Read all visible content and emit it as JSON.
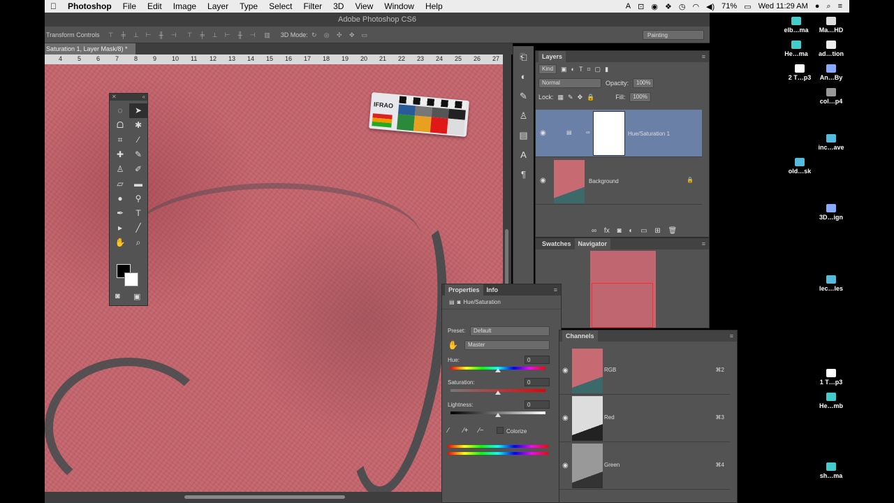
{
  "menubar": {
    "apple": "",
    "app": "Photoshop",
    "items": [
      "File",
      "Edit",
      "Image",
      "Layer",
      "Type",
      "Select",
      "Filter",
      "3D",
      "View",
      "Window",
      "Help"
    ],
    "battery": "71%",
    "clock": "Wed 11:29 AM"
  },
  "window_title": "Adobe Photoshop CS6",
  "options": {
    "transform_label": "Transform Controls",
    "mode3d_label": "3D Mode:",
    "workspace": "Painting"
  },
  "doc_tab": "Saturation 1, Layer Mask/8) *",
  "ruler_ticks": [
    "4",
    "5",
    "6",
    "7",
    "8",
    "9",
    "10",
    "11",
    "12",
    "13",
    "14",
    "15",
    "16",
    "17",
    "18",
    "19",
    "20",
    "21",
    "22",
    "23",
    "24",
    "25",
    "26",
    "27"
  ],
  "layers_panel": {
    "tab": "Layers",
    "kind": "Kind",
    "blend": "Normal",
    "opacity_label": "Opacity:",
    "opacity": "100%",
    "lock_label": "Lock:",
    "fill_label": "Fill:",
    "fill": "100%",
    "layers": [
      {
        "name": "Hue/Saturation 1"
      },
      {
        "name": "Background"
      }
    ]
  },
  "nav_panel": {
    "tabs": [
      "Swatches",
      "Navigator"
    ]
  },
  "properties": {
    "tabs": [
      "Properties",
      "Info"
    ],
    "adjustment": "Hue/Saturation",
    "preset_label": "Preset:",
    "preset": "Default",
    "channel": "Master",
    "hue_label": "Hue:",
    "hue": "0",
    "saturation_label": "Saturation:",
    "saturation": "0",
    "lightness_label": "Lightness:",
    "lightness": "0",
    "colorize": "Colorize"
  },
  "channels_panel": {
    "tab": "Channels",
    "channels": [
      {
        "name": "RGB",
        "shortcut": "⌘2"
      },
      {
        "name": "Red",
        "shortcut": "⌘3"
      },
      {
        "name": "Green",
        "shortcut": "⌘4"
      }
    ]
  },
  "scale_card": {
    "label": "IFRAO"
  },
  "desktop": [
    "elb…ma",
    "Ma…HD",
    "He…ma",
    "ad…tion",
    "2 T…p3",
    "An…By",
    "col…p4",
    "inc…ave",
    "old…sk",
    "3D…ign",
    "lec…les",
    "1 T…p3",
    "He…mb",
    "sh…ma"
  ]
}
